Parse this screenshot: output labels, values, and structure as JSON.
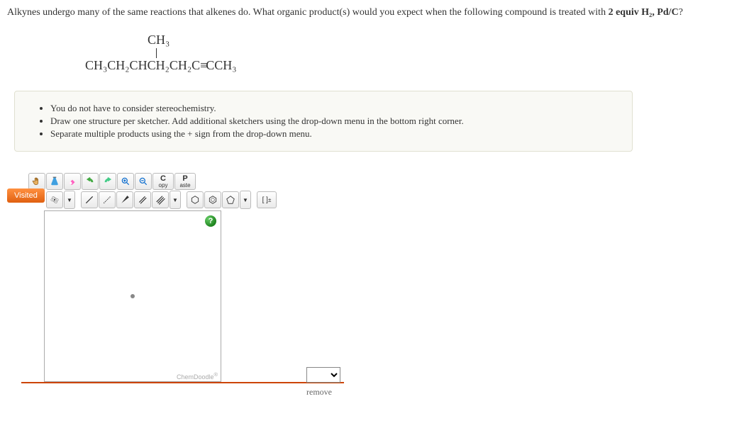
{
  "question": {
    "prefix": "Alkynes undergo many of the same reactions that alkenes do. What organic product(s) would you expect when the following compound is treated with ",
    "bold": "2 equiv H₂, Pd/C",
    "suffix": "?"
  },
  "formula": {
    "top": "CH₃",
    "main_left": "CH₃CH₂CHCH₂CH₂C",
    "main_right": "CCH₃"
  },
  "instructions": [
    "You do not have to consider stereochemistry.",
    "Draw one structure per sketcher. Add additional sketchers using the drop-down menu in the bottom right corner.",
    "Separate multiple products using the + sign from the drop-down menu."
  ],
  "tag": "Visited",
  "toolbar1": {
    "copy_big": "C",
    "copy_small": "opy",
    "paste_big": "P",
    "paste_small": "aste"
  },
  "help": "?",
  "brand": "ChemDoodle",
  "brand_sup": "®",
  "remove_label": "remove"
}
